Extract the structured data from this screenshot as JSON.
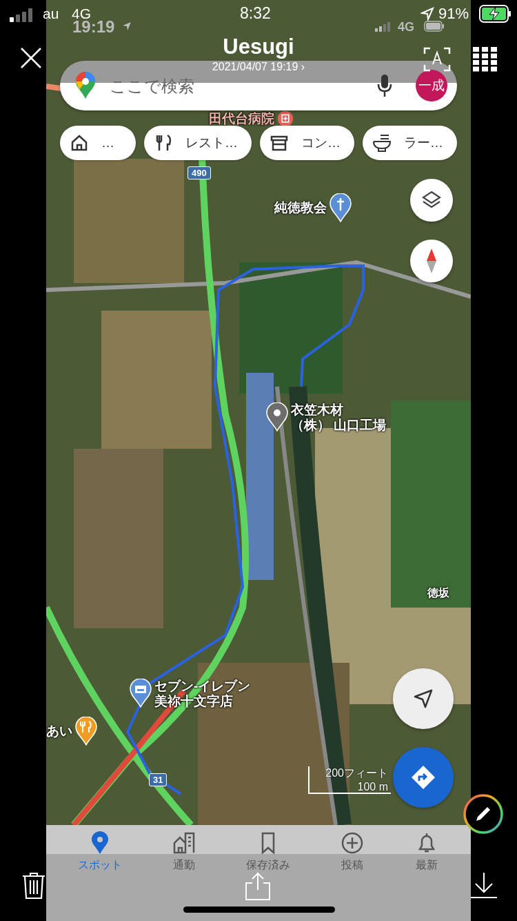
{
  "status_bar": {
    "carrier": "au",
    "network": "4G",
    "time": "8:32",
    "battery": "91%"
  },
  "screenshot_status_bar": {
    "time": "19:19",
    "network": "4G"
  },
  "viewer": {
    "title": "Uesugi",
    "subtitle": "2021/04/07 19:19 ›"
  },
  "search": {
    "placeholder": "ここで検索",
    "avatar": "一成"
  },
  "chips": [
    {
      "kind": "home",
      "label": "…"
    },
    {
      "kind": "restaurant",
      "label": "レスト…"
    },
    {
      "kind": "store",
      "label": "コン…"
    },
    {
      "kind": "ramen",
      "label": "ラー…"
    }
  ],
  "map_labels": [
    {
      "kind": "hospital",
      "lines": [
        "田代台病院"
      ]
    },
    {
      "kind": "road",
      "lines": [
        "490"
      ]
    },
    {
      "kind": "church",
      "lines": [
        "純徳教会"
      ]
    },
    {
      "kind": "pin",
      "lines": [
        "衣笠木材",
        "（株） 山口工場"
      ]
    },
    {
      "kind": "area",
      "lines": [
        "徳坂"
      ]
    },
    {
      "kind": "store",
      "lines": [
        "セブン-イレブン",
        "美祢十文字店"
      ]
    },
    {
      "kind": "restaurant",
      "lines": [
        "あい"
      ]
    },
    {
      "kind": "road",
      "lines": [
        "31"
      ]
    }
  ],
  "scale": {
    "feet": "200フィート",
    "meters": "100 m"
  },
  "nav": [
    {
      "kind": "pin",
      "label": "スポット",
      "selected": true
    },
    {
      "kind": "commute",
      "label": "通勤",
      "selected": false
    },
    {
      "kind": "saved",
      "label": "保存済み",
      "selected": false
    },
    {
      "kind": "post",
      "label": "投稿",
      "selected": false
    },
    {
      "kind": "bell",
      "label": "最新",
      "selected": false
    }
  ]
}
